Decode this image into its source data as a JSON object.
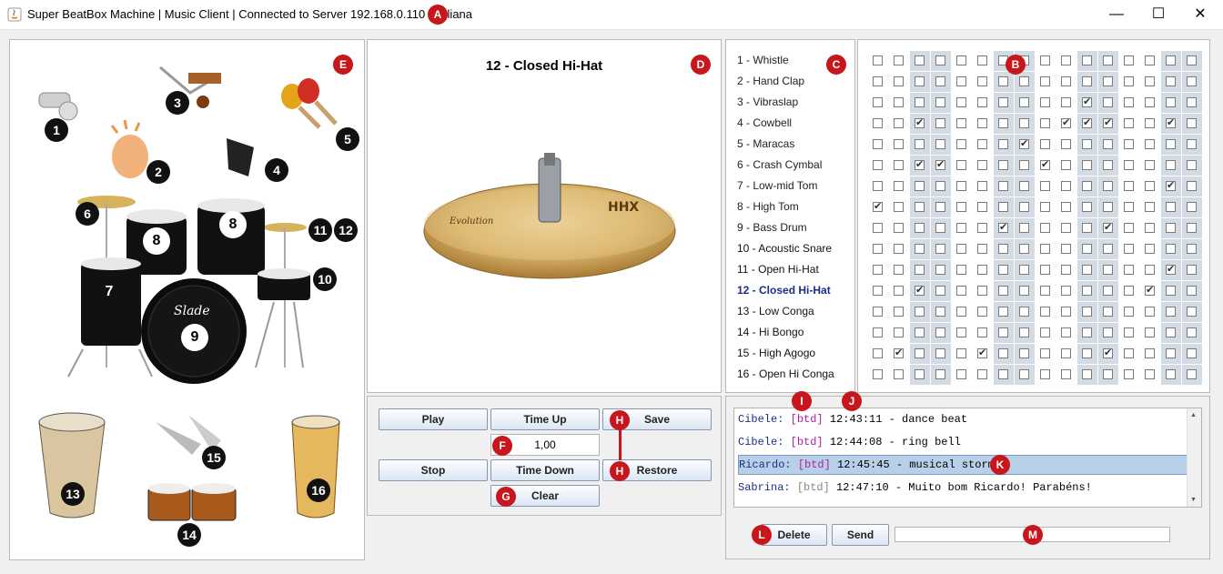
{
  "window": {
    "title": "Super BeatBox Machine | Music Client | Connected to Server 192.168.0.110 | Juliana",
    "controls": {
      "minimize": "—",
      "maximize": "☐",
      "close": "✕"
    }
  },
  "markers": {
    "A": "A",
    "B": "B",
    "C": "C",
    "D": "D",
    "E": "E",
    "F": "F",
    "G": "G",
    "H": "H",
    "I": "I",
    "J": "J",
    "K": "K",
    "L": "L",
    "M": "M"
  },
  "instrument_image_labels": [
    "1",
    "2",
    "3",
    "4",
    "5",
    "6",
    "7",
    "8",
    "8",
    "9",
    "10",
    "11",
    "12",
    "13",
    "14",
    "15",
    "16"
  ],
  "preview": {
    "title": "12 - Closed Hi-Hat",
    "cymbal_brand": "HHX",
    "cymbal_series": "Evolution"
  },
  "instruments": [
    "1 - Whistle",
    "2 - Hand Clap",
    "3 - Vibraslap",
    "4 - Cowbell",
    "5 - Maracas",
    "6 - Crash Cymbal",
    "7 - Low-mid Tom",
    "8 - High Tom",
    "9 - Bass Drum",
    "10 - Acoustic Snare",
    "11 - Open Hi-Hat",
    "12 - Closed Hi-Hat",
    "13 - Low Conga",
    "14 - Hi Bongo",
    "15 - High Agogo",
    "16 - Open Hi Conga"
  ],
  "selected_instrument_index": 11,
  "pattern": [
    [
      0,
      0,
      0,
      0,
      0,
      0,
      0,
      0,
      0,
      0,
      0,
      0,
      0,
      0,
      0,
      0
    ],
    [
      0,
      0,
      0,
      0,
      0,
      0,
      0,
      0,
      0,
      0,
      0,
      0,
      0,
      0,
      0,
      0
    ],
    [
      0,
      0,
      0,
      0,
      0,
      0,
      0,
      0,
      0,
      0,
      1,
      0,
      0,
      0,
      0,
      0
    ],
    [
      0,
      0,
      1,
      0,
      0,
      0,
      0,
      0,
      0,
      1,
      1,
      1,
      0,
      0,
      1,
      0
    ],
    [
      0,
      0,
      0,
      0,
      0,
      0,
      0,
      1,
      0,
      0,
      0,
      0,
      0,
      0,
      0,
      0
    ],
    [
      0,
      0,
      1,
      1,
      0,
      0,
      0,
      0,
      1,
      0,
      0,
      0,
      0,
      0,
      0,
      0
    ],
    [
      0,
      0,
      0,
      0,
      0,
      0,
      0,
      0,
      0,
      0,
      0,
      0,
      0,
      0,
      1,
      0
    ],
    [
      1,
      0,
      0,
      0,
      0,
      0,
      0,
      0,
      0,
      0,
      0,
      0,
      0,
      0,
      0,
      0
    ],
    [
      0,
      0,
      0,
      0,
      0,
      0,
      1,
      0,
      0,
      0,
      0,
      1,
      0,
      0,
      0,
      0
    ],
    [
      0,
      0,
      0,
      0,
      0,
      0,
      0,
      0,
      0,
      0,
      0,
      0,
      0,
      0,
      0,
      0
    ],
    [
      0,
      0,
      0,
      0,
      0,
      0,
      0,
      0,
      0,
      0,
      0,
      0,
      0,
      0,
      1,
      0
    ],
    [
      0,
      0,
      1,
      0,
      0,
      0,
      0,
      0,
      0,
      0,
      0,
      0,
      0,
      1,
      0,
      0
    ],
    [
      0,
      0,
      0,
      0,
      0,
      0,
      0,
      0,
      0,
      0,
      0,
      0,
      0,
      0,
      0,
      0
    ],
    [
      0,
      0,
      0,
      0,
      0,
      0,
      0,
      0,
      0,
      0,
      0,
      0,
      0,
      0,
      0,
      0
    ],
    [
      0,
      1,
      0,
      0,
      0,
      1,
      0,
      0,
      0,
      0,
      0,
      1,
      0,
      0,
      0,
      0
    ],
    [
      0,
      0,
      0,
      0,
      0,
      0,
      0,
      0,
      0,
      0,
      0,
      0,
      0,
      0,
      0,
      0
    ]
  ],
  "controls": {
    "play": "Play",
    "time_up": "Time Up",
    "save": "Save",
    "tempo_value": "1,00",
    "stop": "Stop",
    "time_down": "Time Down",
    "restore": "Restore",
    "clear": "Clear"
  },
  "chat": {
    "messages": [
      {
        "user": "Cibele:",
        "tag": "[btd]",
        "time": "12:43:11",
        "text": "- dance beat",
        "tag_active": true
      },
      {
        "user": "Cibele:",
        "tag": "[btd]",
        "time": "12:44:08",
        "text": "- ring bell",
        "tag_active": true
      },
      {
        "user": "Ricardo:",
        "tag": "[btd]",
        "time": "12:45:45",
        "text": "- musical storm",
        "tag_active": true
      },
      {
        "user": "Sabrina:",
        "tag": "[btd]",
        "time": "12:47:10",
        "text": "- Muito bom Ricardo! Parabéns!",
        "tag_active": false
      }
    ],
    "selected_index": 2,
    "delete_label": "Delete",
    "send_label": "Send",
    "message_input": ""
  }
}
